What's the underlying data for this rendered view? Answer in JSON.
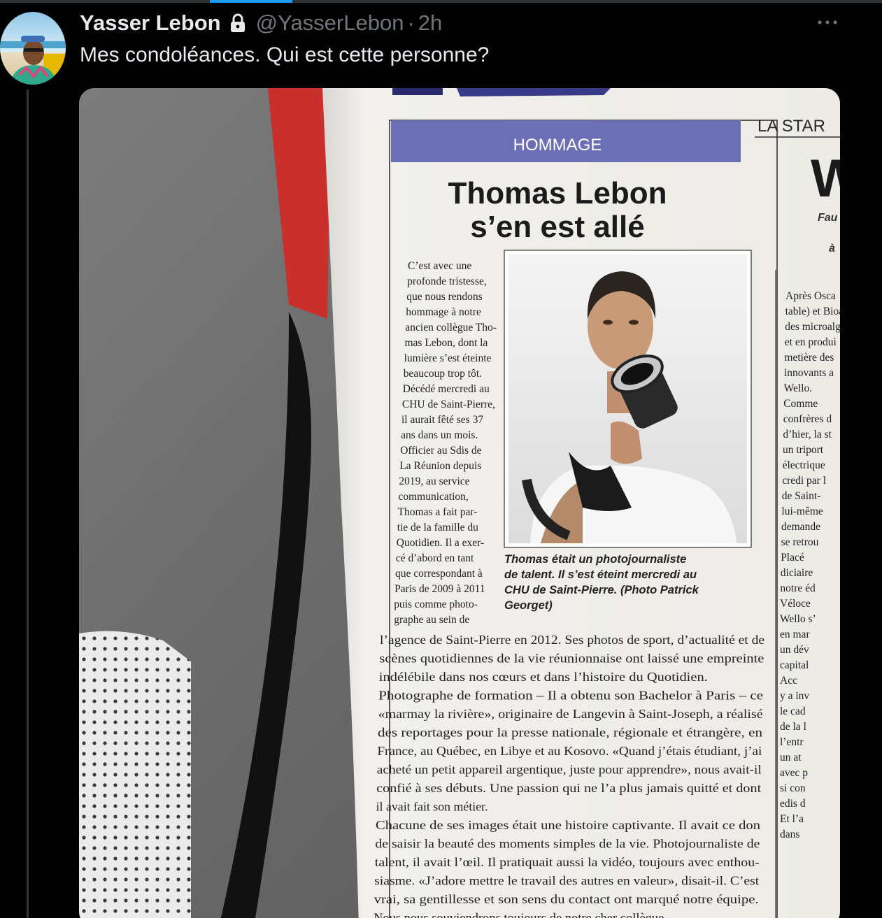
{
  "post": {
    "display_name": "Yasser Lebon",
    "handle": "@YasserLebon",
    "separator": "·",
    "time": "2h",
    "text": "Mes condoléances. Qui est cette personne?",
    "icons": [
      "avatar",
      "lock-icon",
      "more-icon"
    ]
  },
  "newspaper": {
    "section": "HOMMAGE",
    "headline_1": "Thomas Lebon",
    "headline_2": "s’en est allé",
    "neighbor_masthead": "LA STAR",
    "neighbor_big": "W",
    "neighbor_sub_1": "Fau",
    "neighbor_sub_2": "à",
    "col_lines": [
      "C’est avec une",
      "profonde tristesse,",
      "que nous rendons",
      "hommage à notre",
      "ancien collègue Tho-",
      "mas Lebon, dont la",
      "lumière s’est éteinte",
      "beaucoup trop tôt.",
      "Décédé mercredi au",
      "CHU de Saint-Pierre,",
      "il aurait fêté ses 37",
      "ans dans un mois.",
      "Officier au Sdis de",
      "La Réunion depuis",
      "2019, au service",
      "communication,",
      "Thomas a fait par-",
      "tie de la famille du",
      "Quotidien. Il a exer-",
      "cé d’abord en tant",
      "que correspondant à",
      "Paris de 2009 à 2011",
      "puis comme photo-",
      "graphe au sein de"
    ],
    "caption_lines": [
      "Thomas était un photojournaliste",
      "de talent. Il s’est éteint mercredi au",
      "CHU de Saint-Pierre. (Photo Patrick",
      "Georget)"
    ],
    "body_lines": [
      "l’agence de Saint-Pierre en 2012. Ses photos de sport, d’actualité et de",
      "scènes quotidiennes de la vie réunionnaise ont laissé une empreinte",
      "indélébile dans nos cœurs et dans l’histoire du Quotidien.",
      "Photographe de formation – Il a obtenu son Bachelor à Paris – ce",
      "«marmay la rivière», originaire de Langevin à Saint-Joseph, a réalisé",
      "des reportages pour la presse nationale, régionale et étrangère, en",
      "France, au Québec, en Libye et au Kosovo. «Quand j’étais étudiant, j’ai",
      "acheté un petit appareil argentique, juste pour apprendre», nous avait-il",
      "confié à ses débuts. Une passion qui ne l’a plus jamais quitté et dont",
      "il avait fait son métier.",
      "Chacune de ses images était une histoire captivante. Il avait ce don",
      "de saisir la beauté des moments simples de la vie. Photojournaliste de",
      "talent, il avait l’œil. Il pratiquait aussi la vidéo, toujours avec enthou-",
      "siasme. «J’adore mettre le travail des autres en valeur», disait-il. C’est",
      "vrai, sa gentillesse et son sens du contact ont marqué notre équipe.",
      "Nous nous souviendrons toujours de notre cher collègue."
    ],
    "right_lines": [
      "Après Osca",
      "table) et Bioa",
      "des microalg",
      "et en produi",
      "metière des",
      "innovants a",
      "Wello.",
      "Comme",
      "confrères d",
      "d’hier, la st",
      "un triport",
      "électrique",
      "credi par l",
      "de Saint-",
      "lui-même",
      "demande",
      "se retrou",
      "Placé",
      "diciaire",
      "notre éd",
      "Véloce",
      "Wello s’",
      "en mar",
      "un dév",
      "capital",
      "Acc",
      "y a inv",
      "le cad",
      "de la l",
      "l’entr",
      "un at",
      "avec p",
      "si con",
      "edis d",
      "Et l’a",
      "dans"
    ]
  }
}
